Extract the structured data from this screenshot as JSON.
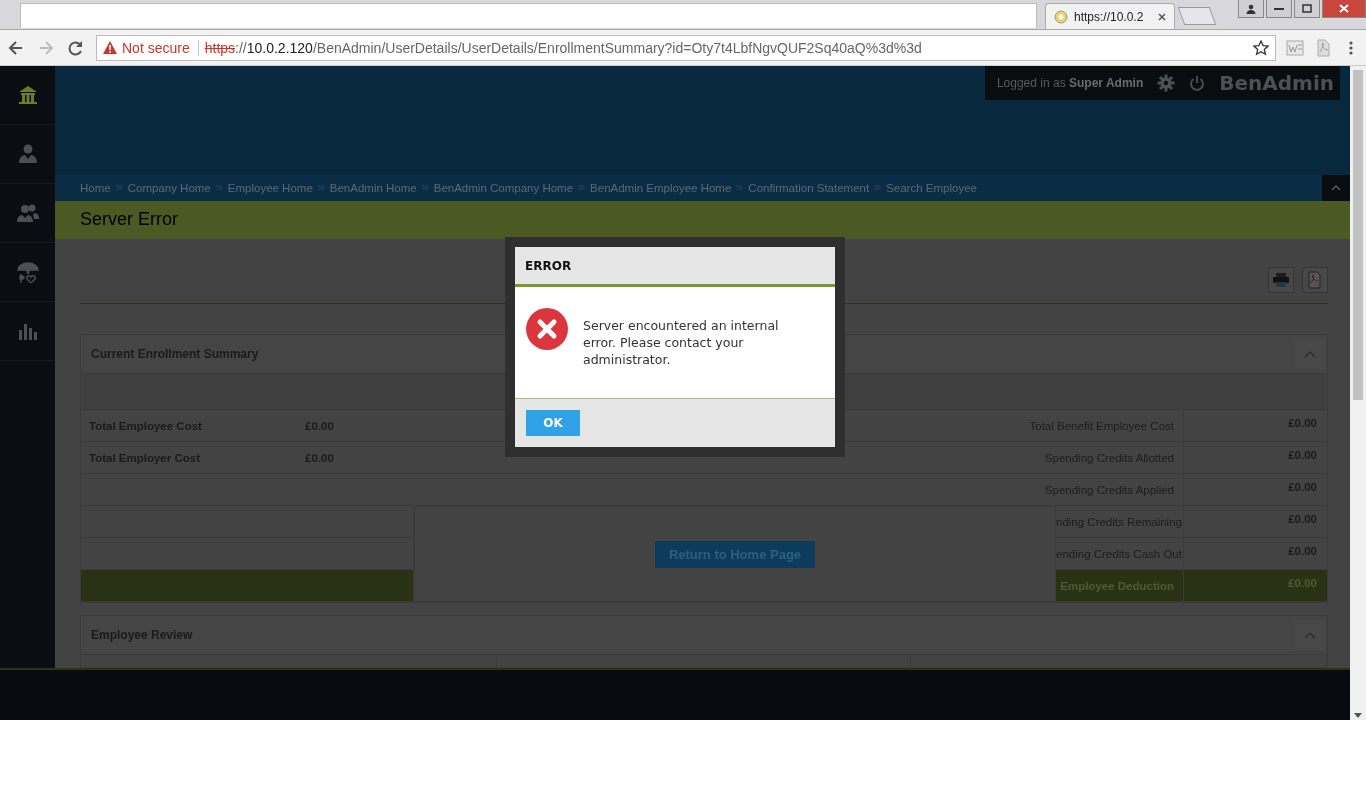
{
  "browser": {
    "tab": {
      "title": "https://10.0.2"
    },
    "security": {
      "label": "Not secure"
    },
    "address": {
      "scheme": "https",
      "separator": "://",
      "host": "10.0.2.120",
      "path": "/BenAdmin/UserDetails/UserDetails/EnrollmentSummary?id=Oty7t4LbfNgvQUF2Sq40aQ%3d%3d"
    }
  },
  "header": {
    "login": "Logged in as **Super Admin**",
    "brand": "BenAdmin"
  },
  "sidebar": {
    "items": [
      {
        "kind": "home",
        "selected": true
      },
      {
        "kind": "person",
        "selected": false
      },
      {
        "kind": "people",
        "selected": false
      },
      {
        "kind": "benefits",
        "selected": false
      },
      {
        "kind": "chart",
        "selected": false
      }
    ]
  },
  "breadcrumbs": [
    "Home",
    "Company Home",
    "Employee Home",
    "BenAdmin Home",
    "BenAdmin Company Home",
    "BenAdmin Employee Home",
    "Confirmation Statement",
    "Search Employee"
  ],
  "page_title": "Server Error",
  "summary": {
    "title": "Current Enrollment Summary",
    "expanded": true,
    "left_rows": [
      {
        "label": "Total Employee Cost",
        "value": "£0.00"
      },
      {
        "label": "Total Employer Cost",
        "value": "£0.00"
      }
    ],
    "rows": [
      {
        "kind": "wide",
        "label": "Total Benefit Employee Cost",
        "value": "£0.00"
      },
      {
        "kind": "wide",
        "label": "Spending Credits Allotted",
        "value": "£0.00"
      },
      {
        "kind": "wide",
        "label": "Spending Credits Applied",
        "value": "£0.00"
      },
      {
        "kind": "narrow",
        "label": "nding Credits Remaining",
        "value": "£0.00"
      },
      {
        "kind": "narrow",
        "label": "ending Credits Cash Out",
        "value": "£0.00"
      },
      {
        "kind": "total",
        "label": "Employee Deduction",
        "value": "£0.00"
      }
    ],
    "return_button": "Return to Home Page"
  },
  "employee_review": {
    "title": "Employee Review",
    "expanded": true
  },
  "dialog": {
    "title": "ERROR",
    "message": "Server encountered an internal error. Please contact your administrator.",
    "button": "OK"
  }
}
